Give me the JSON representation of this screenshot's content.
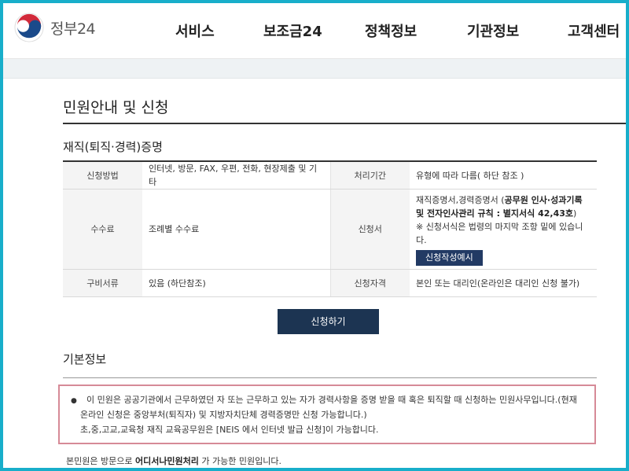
{
  "header": {
    "logo_text": "정부24",
    "nav": [
      "서비스",
      "보조금24",
      "정책정보",
      "기관정보",
      "고객센터"
    ]
  },
  "page": {
    "title": "민원안내 및 신청",
    "section_title": "재직(퇴직·경력)증명"
  },
  "info_table": {
    "row1": {
      "label": "신청방법",
      "value": "인터넷, 방문, FAX, 우편, 전화, 현장제출 및 기타",
      "label2": "처리기간",
      "value2": "유형에 따라 다름( 하단 참조 )"
    },
    "row2": {
      "label": "수수료",
      "value": "조례별 수수료",
      "label2": "신청서",
      "value2_a": "재직증명서,경력증명서 (",
      "value2_b": "공무원 인사·성과기록 및 전자인사관리 규칙 : 별지서식 42,43호",
      "value2_c": ")",
      "value2_note": "※ 신청서식은 법령의 마지막 조항 밑에 있습니다.",
      "form_button": "신청작성예시"
    },
    "row3": {
      "label": "구비서류",
      "value": "있음 (하단참조)",
      "label2": "신청자격",
      "value2": "본인 또는 대리인(온라인은 대리인 신청 불가)"
    }
  },
  "apply_button": "신청하기",
  "basic_info": {
    "title": "기본정보",
    "bullet": "●",
    "line1": "이 민원은 공공기관에서 근무하였던 자 또는 근무하고 있는 자가 경력사항을 증명 받을 때 혹은 퇴직할 때 신청하는 민원사무입니다.(현재",
    "line2": "온라인 신청은 중앙부처(퇴직자) 및 지방자치단체 경력증명만 신청 가능합니다.)",
    "line3": "초,중,고교,교육청 재직 교육공무원은 [NEIS 에서 인터넷 발급 신청]이 가능합니다.",
    "footer_a": "본민원은 방문으로 ",
    "footer_b": "어디서나민원처리",
    "footer_c": " 가 가능한 민원입니다."
  },
  "colors": {
    "frame": "#18aeca",
    "button_navy": "#1c3452",
    "notice_border": "#d68a97"
  }
}
